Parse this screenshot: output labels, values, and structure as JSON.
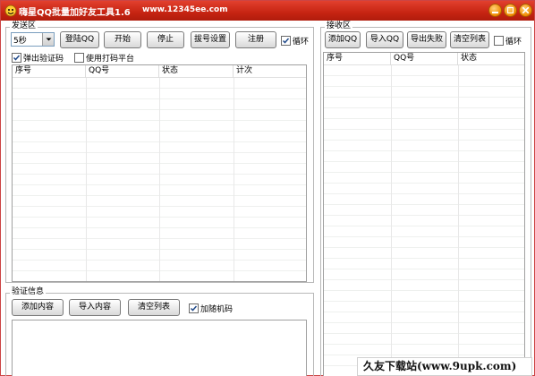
{
  "window": {
    "title": "嗨星QQ批量加好友工具1.6",
    "url": "www.12345ee.com"
  },
  "send_group": {
    "label": "发送区",
    "interval_select": "5秒",
    "buttons": {
      "login_qq": "登陆QQ",
      "start": "开始",
      "stop": "停止",
      "dial_settings": "拔号设置",
      "register": "注册"
    },
    "loop_checkbox": {
      "label": "循环",
      "checked": true
    },
    "popup_captcha_checkbox": {
      "label": "弹出验证码",
      "checked": true
    },
    "use_captcha_platform_checkbox": {
      "label": "使用打码平台",
      "checked": false
    },
    "columns": [
      "序号",
      "QQ号",
      "状态",
      "计次"
    ]
  },
  "verify_group": {
    "label": "验证信息",
    "buttons": {
      "add_content": "添加内容",
      "import_content": "导入内容",
      "clear_list": "清空列表"
    },
    "random_code_checkbox": {
      "label": "加随机码",
      "checked": true
    }
  },
  "receive_group": {
    "label": "接收区",
    "buttons": {
      "add_qq": "添加QQ",
      "import_qq": "导入QQ",
      "export_failed": "导出失败",
      "clear_list": "清空列表"
    },
    "loop_checkbox": {
      "label": "循环",
      "checked": false
    },
    "columns": [
      "序号",
      "QQ号",
      "状态"
    ]
  },
  "watermark": {
    "text": "久友下载站(www.9upk.com)"
  }
}
